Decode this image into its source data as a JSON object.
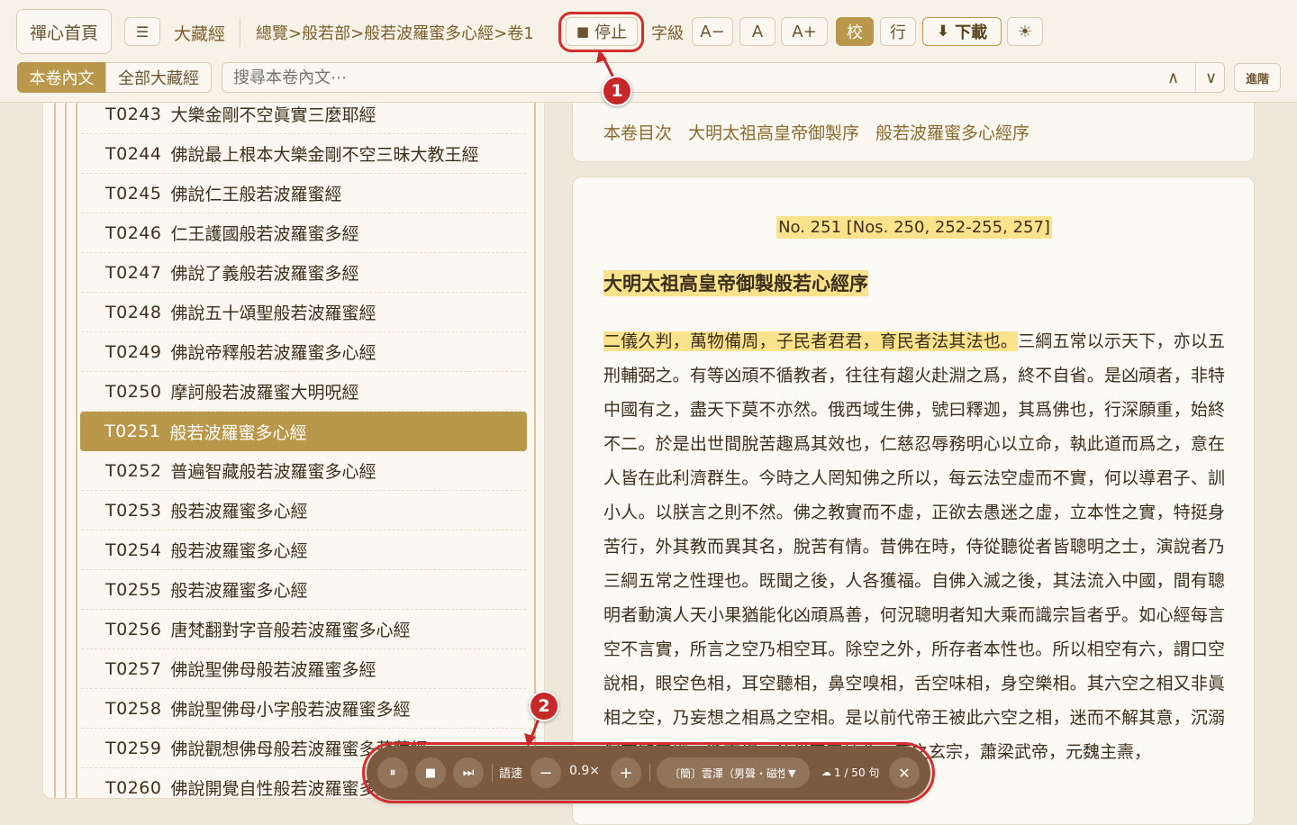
{
  "topbar": {
    "home_label": "禪心首頁",
    "menu_icon": "hamburger-icon",
    "menu_glyph": "☰",
    "canon_label": "大藏經",
    "breadcrumb": "總覽>般若部>般若波羅蜜多心經>卷1",
    "stop_label": "停止",
    "stop_glyph": "■",
    "font_size_label": "字級",
    "font_decrease": "A−",
    "font_normal": "A",
    "font_increase": "A+",
    "proofread_label": "校",
    "line_label": "行",
    "download_label": "下載",
    "download_glyph": "⬇",
    "theme_glyph": "☀",
    "theme_icon": "sun-icon"
  },
  "search": {
    "scope_current": "本卷內文",
    "scope_all": "全部大藏經",
    "placeholder": "搜尋本卷內文⋯",
    "prev_glyph": "∧",
    "next_glyph": "∨",
    "advanced_label": "進階"
  },
  "sidebar": {
    "items": [
      {
        "code": "T0243",
        "title": "大樂金剛不空眞實三麼耶經"
      },
      {
        "code": "T0244",
        "title": "佛說最上根本大樂金剛不空三昧大教王經"
      },
      {
        "code": "T0245",
        "title": "佛說仁王般若波羅蜜經"
      },
      {
        "code": "T0246",
        "title": "仁王護國般若波羅蜜多經"
      },
      {
        "code": "T0247",
        "title": "佛說了義般若波羅蜜多經"
      },
      {
        "code": "T0248",
        "title": "佛說五十頌聖般若波羅蜜經"
      },
      {
        "code": "T0249",
        "title": "佛說帝釋般若波羅蜜多心經"
      },
      {
        "code": "T0250",
        "title": "摩訶般若波羅蜜大明呪經"
      },
      {
        "code": "T0251",
        "title": "般若波羅蜜多心經"
      },
      {
        "code": "T0252",
        "title": "普遍智藏般若波羅蜜多心經"
      },
      {
        "code": "T0253",
        "title": "般若波羅蜜多心經"
      },
      {
        "code": "T0254",
        "title": "般若波羅蜜多心經"
      },
      {
        "code": "T0255",
        "title": "般若波羅蜜多心經"
      },
      {
        "code": "T0256",
        "title": "唐梵翻對字音般若波羅蜜多心經"
      },
      {
        "code": "T0257",
        "title": "佛說聖佛母般若波羅蜜多經"
      },
      {
        "code": "T0258",
        "title": "佛說聖佛母小字般若波羅蜜多經"
      },
      {
        "code": "T0259",
        "title": "佛說觀想佛母般若波羅蜜多菩薩經"
      },
      {
        "code": "T0260",
        "title": "佛說開覺自性般若波羅蜜多經"
      }
    ],
    "selected_index": 8
  },
  "toc": {
    "label": "本卷目次",
    "links": [
      "大明太祖高皇帝御製序",
      "般若波羅蜜多心經序"
    ]
  },
  "content": {
    "sutra_no": "No. 251 [Nos. 250, 252-255, 257]",
    "heading": "大明太祖高皇帝御製般若心經序",
    "highlight_sentence": "二儀久判，萬物備周，子民者君君，育民者法其法也。",
    "body": "三綱五常以示天下，亦以五刑輔弼之。有等凶頑不循教者，往往有趨火赴淵之爲，終不自省。是凶頑者，非特中國有之，盡天下莫不亦然。俄西域生佛，號曰釋迦，其爲佛也，行深願重，始終不二。於是出世間脫苦趣爲其效也，仁慈忍辱務明心以立命，執此道而爲之，意在人皆在此利濟群生。今時之人罔知佛之所以，每云法空虛而不實，何以導君子、訓小人。以朕言之則不然。佛之教實而不虛，正欲去愚迷之虛，立本性之實，特挺身苦行，外其教而異其名，脫苦有情。昔佛在時，侍從聽從者皆聰明之士，演說者乃三綱五常之性理也。既聞之後，人各獲福。自佛入滅之後，其法流入中國，間有聰明者動演人天小果猶能化凶頑爲善，何況聰明者知大乘而識宗旨者乎。如心經每言空不言實，所言之空乃相空耳。除空之外，所存者本性也。所以相空有六，謂口空說相，眼空色相，耳空聽相，鼻空嗅相，舌空味相，身空樂相。其六空之相又非眞相之空，乃妄想之相爲之空相。是以前代帝王被此六空之相，迷而不解其意，沉溺深不知其幾。斯空相，前代帝王被此，唐之玄宗，蕭梁武帝，元魏主燾，"
  },
  "player": {
    "pause_glyph": "⏸",
    "stop_glyph": "■",
    "next_glyph": "⏭",
    "speed_label": "語速",
    "minus_glyph": "−",
    "speed_value": "0.9×",
    "plus_glyph": "+",
    "voice_value": "〔簡〕雲澤（男聲・磁性）",
    "progress_text": "1 / 50 句",
    "close_glyph": "✕"
  },
  "annotations": {
    "badge1": "1",
    "badge2": "2"
  },
  "colors": {
    "accent": "#b9974b",
    "player_bg": "#7b5a3f",
    "highlight": "#fbe28c",
    "annotation_red": "#d32f2f"
  }
}
